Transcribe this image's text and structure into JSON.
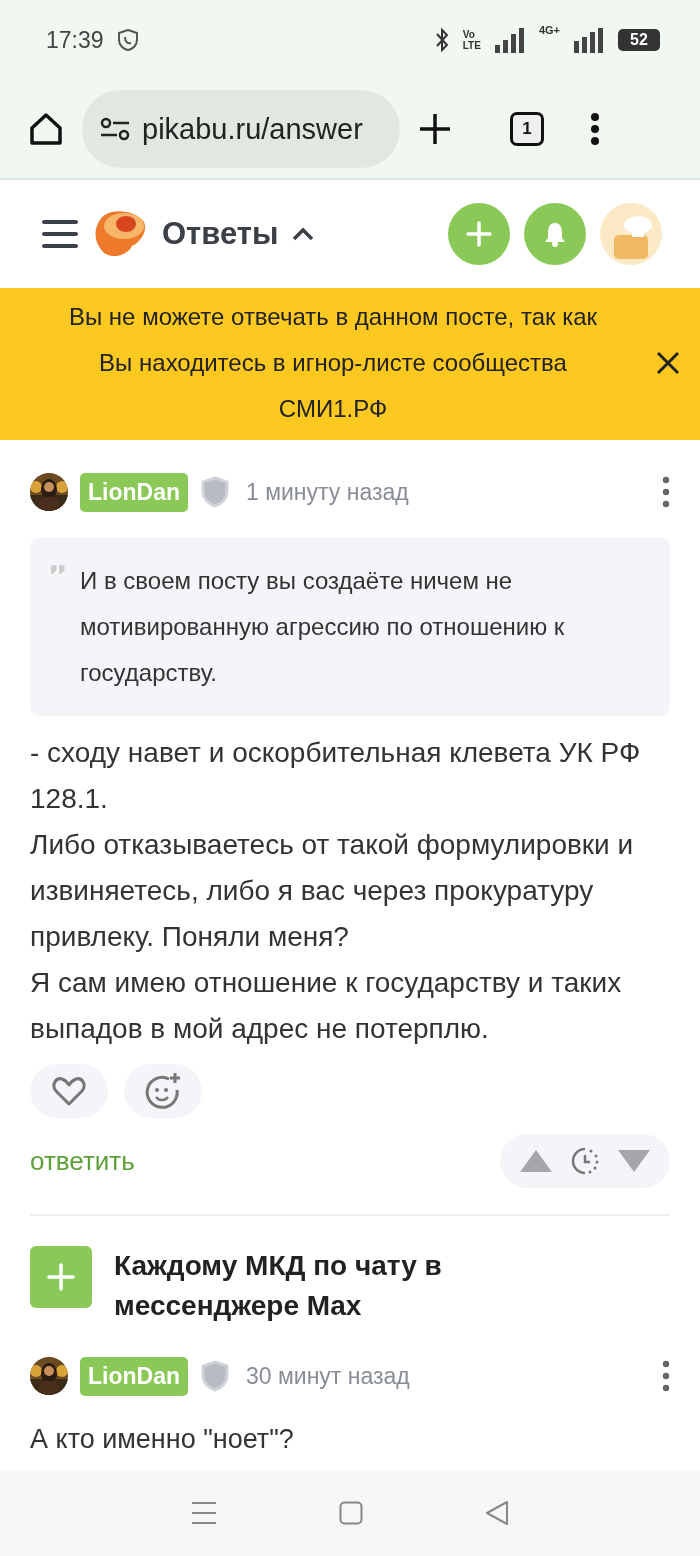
{
  "status_bar": {
    "time": "17:39",
    "volte": "Vo",
    "lte": "LTE",
    "network": "4G+",
    "battery": "52"
  },
  "browser": {
    "url": "pikabu.ru/answer",
    "tab_count": "1"
  },
  "header": {
    "title": "Ответы",
    "expanded": true
  },
  "banner": {
    "text": "Вы не можете отвечать в данном посте, так как\nВы находитесь в игнор-листе сообщества\nСМИ1.РФ"
  },
  "comments": [
    {
      "author": "LionDan",
      "time": "1 минуту назад",
      "quote": "И в своем посту вы создаёте ничем не мотивированную агрессию по отношению к государству.",
      "body": "- сходу навет и оскорбительная клевета УК РФ 128.1.\nЛибо отказываетесь от такой формулировки и извиняетесь, либо я вас через прокуратуру привлеку. Поняли меня?\nЯ сам имею отношение к государству и таких выпадов в мой адрес не потерплю.",
      "liked": false,
      "reply": "ответить"
    }
  ],
  "post": {
    "title": "Каждому МКД по чату в мессенджере Max"
  },
  "post_comment": {
    "author": "LionDan",
    "time": "30 минут назад",
    "body": "А кто именно \"ноет\"?"
  }
}
